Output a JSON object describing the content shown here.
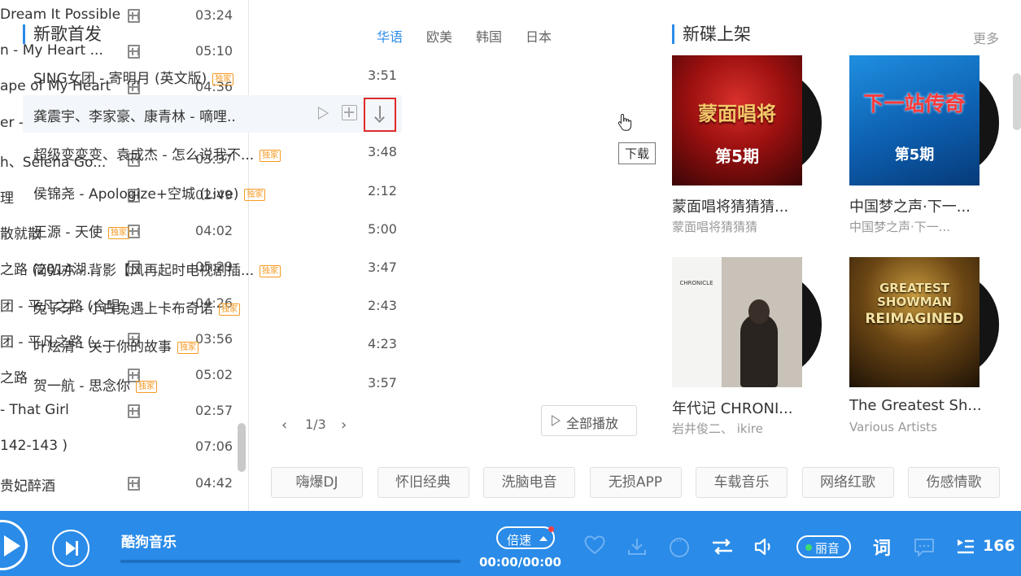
{
  "left_playlist": [
    {
      "title": "Dream It Possible",
      "duration": "03:24",
      "mv": true
    },
    {
      "title": "n - My Heart ...",
      "duration": "05:10",
      "mv": true
    },
    {
      "title": "ape of My Heart",
      "duration": "04:36",
      "mv": true
    },
    {
      "title": "er - Faded",
      "duration": "03:33",
      "mv": true
    },
    {
      "title": "h、Selena Go...",
      "duration": "03:37",
      "mv": true
    },
    {
      "title": "理",
      "duration": "02:49",
      "mv": true
    },
    {
      "title": "散就散",
      "duration": "04:02",
      "mv": true
    },
    {
      "title": "之路 (2014湖...",
      "duration": "05:29",
      "mv": true
    },
    {
      "title": "团 - 平凡之路 (合唱...",
      "duration": "04:26",
      "mv": false
    },
    {
      "title": "团 - 平凡之路 (...",
      "duration": "03:56",
      "mv": true
    },
    {
      "title": "之路",
      "duration": "05:02",
      "mv": true
    },
    {
      "title": "- That Girl",
      "duration": "02:57",
      "mv": true
    },
    {
      "title": "142-143 )",
      "duration": "07:06",
      "mv": false
    },
    {
      "title": "贵妃醉酒",
      "duration": "04:42",
      "mv": true
    }
  ],
  "new_songs": {
    "title": "新歌首发",
    "tabs": [
      {
        "label": "华语",
        "active": true
      },
      {
        "label": "欧美",
        "active": false
      },
      {
        "label": "韩国",
        "active": false
      },
      {
        "label": "日本",
        "active": false
      }
    ],
    "badge": "独家",
    "songs": [
      {
        "title": "SING女团 - 寄明月 (英文版)",
        "duration": "3:51",
        "badge": true
      },
      {
        "title": "龚震宇、李家豪、康青林 - 嘀哩..",
        "duration": "",
        "badge": false,
        "hover": true
      },
      {
        "title": "超级变变变、袁成杰 - 怎么说我不...",
        "duration": "3:48",
        "badge": true
      },
      {
        "title": "侯锦尧 - Apologize+空城 (Live)",
        "duration": "2:12",
        "badge": true
      },
      {
        "title": "王源 - 天使",
        "duration": "5:00",
        "badge": true
      },
      {
        "title": "简弘亦 - 背影【风再起时电视剧插...",
        "duration": "3:47",
        "badge": true
      },
      {
        "title": "兔子牙 - 小白兔遇上卡布奇诺",
        "duration": "2:43",
        "badge": true
      },
      {
        "title": "叶炫清 - 关于你的故事",
        "duration": "4:23",
        "badge": true
      },
      {
        "title": "贺一航 - 思念你",
        "duration": "3:57",
        "badge": true
      }
    ],
    "tooltip": "下载",
    "pager": {
      "prev": "‹",
      "text": "1/3",
      "next": "›"
    },
    "play_all": "全部播放"
  },
  "new_albums": {
    "title": "新碟上架",
    "more": "更多",
    "albums": [
      {
        "name": "蒙面唱将猜猜猜...",
        "artist": "蒙面唱将猜猜猜",
        "cover_text": "蒙面唱将",
        "cover_sub": "第5期"
      },
      {
        "name": "中国梦之声·下一...",
        "artist": "中国梦之声·下一...",
        "cover_text": "下一站传奇",
        "cover_sub": "第5期"
      },
      {
        "name": "年代记 CHRONI...",
        "artist": "岩井俊二、 ikire",
        "cover_text": "CHRONICLE",
        "cover_sub": ""
      },
      {
        "name": "The Greatest Sh...",
        "artist": "Various Artists",
        "cover_text": "GREATEST SHOWMAN",
        "cover_sub": "REIMAGINED"
      }
    ]
  },
  "tags": [
    "嗨爆DJ",
    "怀旧经典",
    "洗脑电音",
    "无损APP",
    "车载音乐",
    "网络红歌",
    "伤感情歌"
  ],
  "player": {
    "app_name": "酷狗音乐",
    "speed_label": "倍速",
    "time": "00:00/00:00",
    "quality_label": "丽音",
    "lyric_label": "词",
    "playlist_count": "166"
  },
  "colors": {
    "accent": "#2a8be8",
    "badge": "#f59a23",
    "highlight": "#e02a2a"
  }
}
